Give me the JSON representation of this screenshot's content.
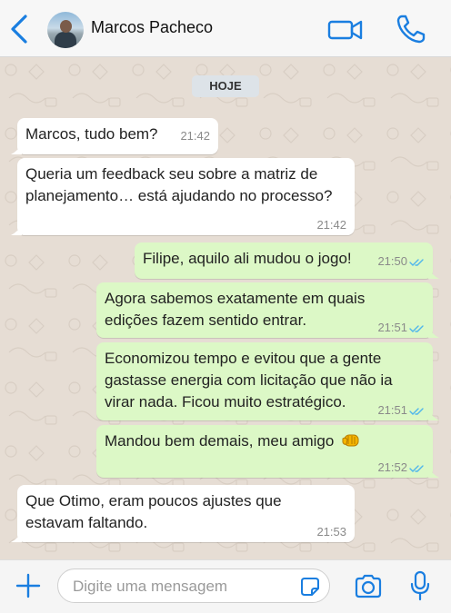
{
  "header": {
    "contact_name": "Marcos Pacheco"
  },
  "chat": {
    "day_label": "HOJE",
    "messages": [
      {
        "direction": "in",
        "text": "Marcos, tudo bem?",
        "time": "21:42"
      },
      {
        "direction": "in",
        "text": "Queria um feedback seu sobre a matriz de planejamento… está ajudando no processo?",
        "time": "21:42"
      },
      {
        "direction": "out",
        "text": "Filipe, aquilo ali mudou o jogo!",
        "time": "21:50",
        "status": "read"
      },
      {
        "direction": "out",
        "text": "Agora sabemos exatamente em quais edições fazem sentido entrar.",
        "time": "21:51",
        "status": "read"
      },
      {
        "direction": "out",
        "text": "Economizou tempo e evitou que a gente gastasse energia com licitação que não ia virar nada. Ficou muito estratégico.",
        "time": "21:51",
        "status": "read"
      },
      {
        "direction": "out",
        "text": "Mandou bem demais, meu amigo",
        "time": "21:52",
        "status": "read",
        "emoji": "fist-bump-icon"
      },
      {
        "direction": "in",
        "text": "Que Otimo, eram poucos ajustes que estavam faltando.",
        "time": "21:53"
      }
    ]
  },
  "composer": {
    "placeholder": "Digite uma mensagem"
  },
  "icons": {
    "back": "chevron-left-icon",
    "video": "video-camera-icon",
    "phone": "phone-icon",
    "add": "plus-icon",
    "sticker": "sticker-icon",
    "camera": "camera-icon",
    "mic": "microphone-icon"
  },
  "colors": {
    "accent": "#1a7ee0",
    "incoming_bubble": "#ffffff",
    "outgoing_bubble": "#dcf8c6",
    "chat_background": "#e6ddd4",
    "read_ticks": "#4fb6ec"
  }
}
